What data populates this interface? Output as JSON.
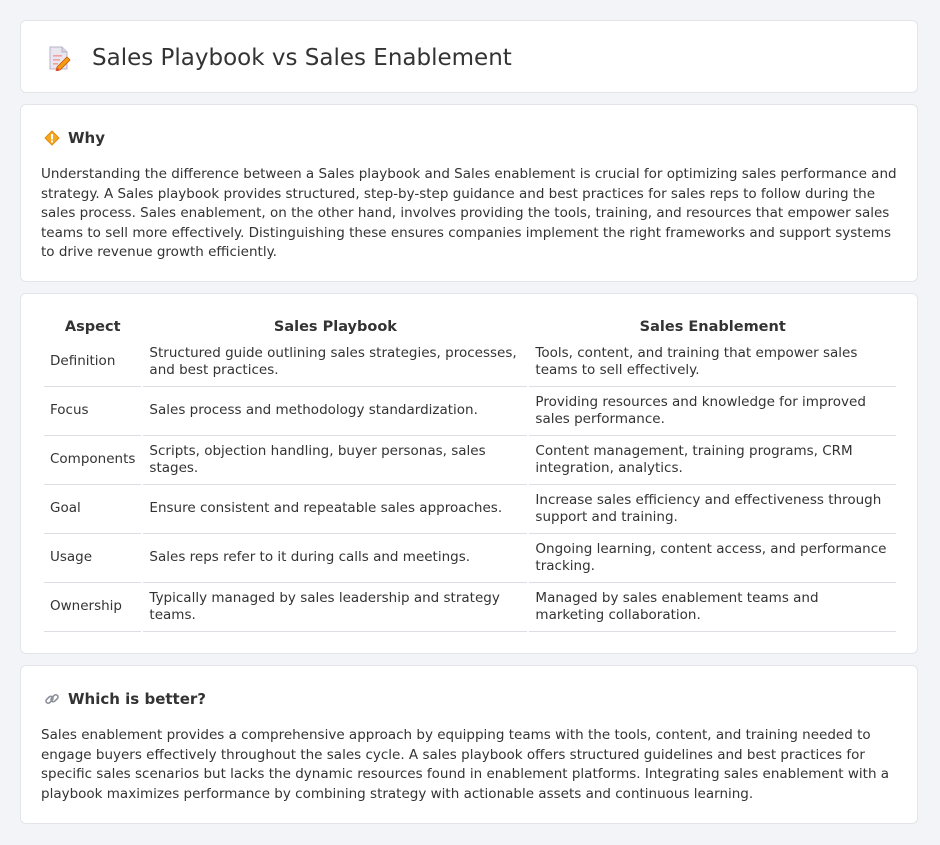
{
  "page": {
    "title": "Sales Playbook vs Sales Enablement",
    "title_icon": "document-pencil-icon"
  },
  "why": {
    "icon": "diamond-icon",
    "heading": "Why",
    "body": "Understanding the difference between a Sales playbook and Sales enablement is crucial for optimizing sales performance and strategy. A Sales playbook provides structured, step-by-step guidance and best practices for sales reps to follow during the sales process. Sales enablement, on the other hand, involves providing the tools, training, and resources that empower sales teams to sell more effectively. Distinguishing these ensures companies implement the right frameworks and support systems to drive revenue growth efficiently."
  },
  "comparison": {
    "headers": [
      "Aspect",
      "Sales Playbook",
      "Sales Enablement"
    ],
    "rows": [
      [
        "Definition",
        "Structured guide outlining sales strategies, processes, and best practices.",
        "Tools, content, and training that empower sales teams to sell effectively."
      ],
      [
        "Focus",
        "Sales process and methodology standardization.",
        "Providing resources and knowledge for improved sales performance."
      ],
      [
        "Components",
        "Scripts, objection handling, buyer personas, sales stages.",
        "Content management, training programs, CRM integration, analytics."
      ],
      [
        "Goal",
        "Ensure consistent and repeatable sales approaches.",
        "Increase sales efficiency and effectiveness through support and training."
      ],
      [
        "Usage",
        "Sales reps refer to it during calls and meetings.",
        "Ongoing learning, content access, and performance tracking."
      ],
      [
        "Ownership",
        "Typically managed by sales leadership and strategy teams.",
        "Managed by sales enablement teams and marketing collaboration."
      ]
    ]
  },
  "better": {
    "icon": "link-icon",
    "heading": "Which is better?",
    "body": "Sales enablement provides a comprehensive approach by equipping teams with the tools, content, and training needed to engage buyers effectively throughout the sales cycle. A sales playbook offers structured guidelines and best practices for specific sales scenarios but lacks the dynamic resources found in enablement platforms. Integrating sales enablement with a playbook maximizes performance by combining strategy with actionable assets and continuous learning."
  }
}
